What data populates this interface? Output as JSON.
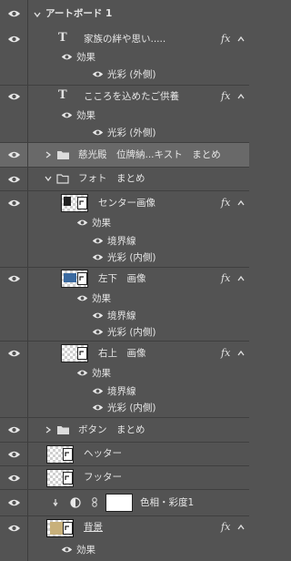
{
  "layers": {
    "artboard_label": "アートボード 1",
    "text_layer_1": "家族の絆や思い.....",
    "text_layer_2": "こころを込めたご供養",
    "effects_label": "効果",
    "outer_glow_label": "光彩 (外側)",
    "inner_glow_label": "光彩 (内側)",
    "stroke_label": "境界線",
    "group_jikoden": "慈光殿　位牌納...キスト　まとめ",
    "group_photo": "フォト　まとめ",
    "layer_center": "センター画像",
    "layer_bottom_left": "左下　画像",
    "layer_top_right": "右上　画像",
    "group_button": "ボタン　まとめ",
    "layer_header": "ヘッター",
    "layer_footer": "フッター",
    "adjustment_layer": "色相・彩度1",
    "layer_background": "背景",
    "fx_label": "fx"
  },
  "colors": {
    "panel_bg": "#535353",
    "selected_bg": "#696969",
    "text": "#e6e6e6"
  }
}
